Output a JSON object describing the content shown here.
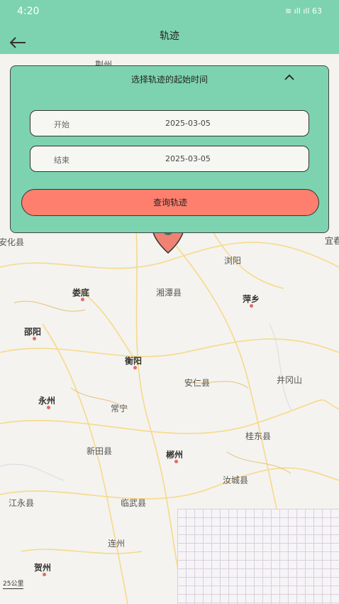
{
  "status_bar": {
    "time": "4:20",
    "right": "≋ ıll ıll 63"
  },
  "header": {
    "title": "轨迹"
  },
  "filter": {
    "title": "选择轨迹的起始时间",
    "start_label": "开始",
    "start_value": "2025-03-05",
    "end_label": "结束",
    "end_value": "2025-03-05",
    "query_button": "查询轨迹"
  },
  "map": {
    "labels": [
      "荆州",
      "安化县",
      "浏阳",
      "宜春",
      "娄底",
      "湘潭县",
      "萍乡",
      "邵阳",
      "衡阳",
      "安仁县",
      "井冈山",
      "永州",
      "常宁",
      "桂东县",
      "新田县",
      "郴州",
      "汝城县",
      "江永县",
      "临武县",
      "连州",
      "贺州"
    ],
    "scale": "25公里"
  },
  "colors": {
    "accent": "#7dd3b0",
    "button": "#ff7f6e"
  }
}
